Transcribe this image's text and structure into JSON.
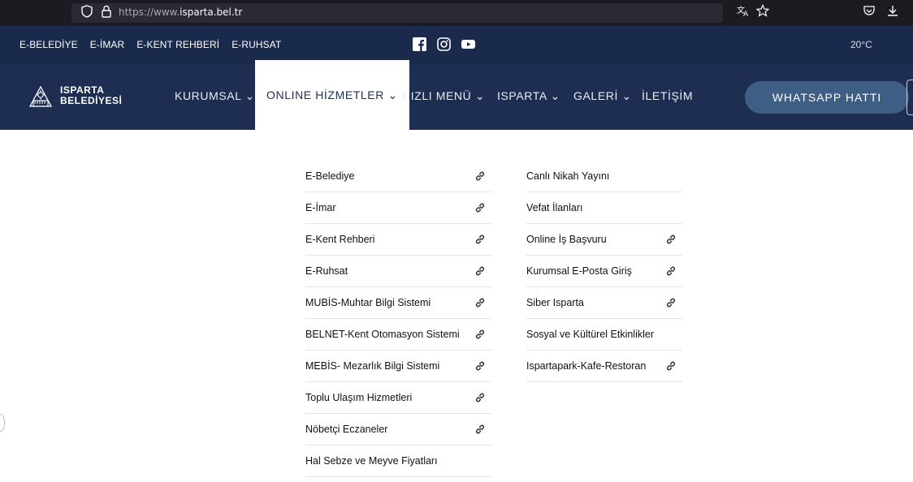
{
  "browser": {
    "url_prefix": "https://www.",
    "url_domain": "isparta.bel.tr"
  },
  "topbar": {
    "links": [
      "E-BELEDİYE",
      "E-İMAR",
      "E-KENT REHBERİ",
      "E-RUHSAT"
    ],
    "temperature": "20°C"
  },
  "logo": {
    "line1": "ISPARTA",
    "line2": "BELEDİYESİ"
  },
  "nav": {
    "kurumsal": "KURUMSAL ⌄",
    "online": "ONLINE HİZMETLER ⌄",
    "hizli": "HIZLI MENÜ ⌄",
    "isparta": "ISPARTA ⌄",
    "galeri": "GALERİ ⌄",
    "iletisim": "İLETİŞİM",
    "whatsapp": "WHATSAPP HATTI"
  },
  "menu": {
    "left": [
      {
        "label": "E-Belediye"
      },
      {
        "label": "E-İmar"
      },
      {
        "label": "E-Kent Rehberi"
      },
      {
        "label": "E-Ruhsat"
      },
      {
        "label": "MUBİS-Muhtar Bilgi Sistemi"
      },
      {
        "label": "BELNET-Kent Otomasyon Sistemi"
      },
      {
        "label": "MEBİS- Mezarlık Bilgi Sistemi"
      },
      {
        "label": "Toplu Ulaşım Hizmetleri"
      },
      {
        "label": "Nöbetçi Eczaneler"
      },
      {
        "label": "Hal Sebze ve Meyve Fiyatları"
      }
    ],
    "right": [
      {
        "label": "Canlı Nikah Yayını"
      },
      {
        "label": "Vefat İlanları"
      },
      {
        "label": "Online İş Başvuru"
      },
      {
        "label": "Kurumsal E-Posta Giriş"
      },
      {
        "label": "Siber Isparta"
      },
      {
        "label": "Sosyal ve Kültürel Etkinlikler"
      },
      {
        "label": "Ispartapark-Kafe-Restoran"
      }
    ]
  }
}
